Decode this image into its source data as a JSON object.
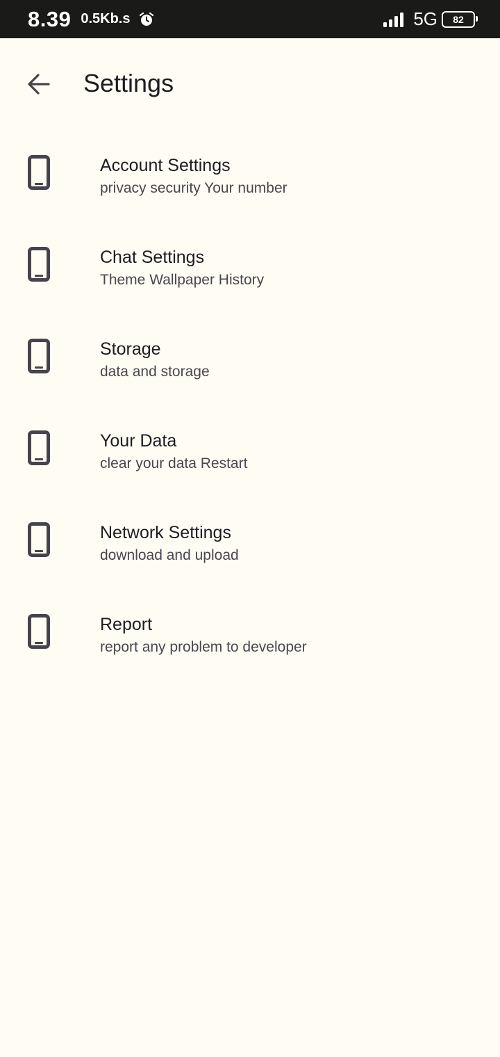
{
  "status_bar": {
    "time": "8.39",
    "speed": "0.5Kb.s",
    "network": "5G",
    "battery": "82"
  },
  "header": {
    "title": "Settings"
  },
  "settings": [
    {
      "title": "Account Settings",
      "subtitle": "privacy security Your number"
    },
    {
      "title": "Chat Settings",
      "subtitle": "Theme Wallpaper History"
    },
    {
      "title": "Storage",
      "subtitle": "data and storage"
    },
    {
      "title": "Your Data",
      "subtitle": "clear your data Restart"
    },
    {
      "title": "Network Settings",
      "subtitle": "download and upload"
    },
    {
      "title": "Report",
      "subtitle": "report any problem to developer"
    }
  ],
  "icons": {
    "back": "arrow-back-icon",
    "item": "smartphone-icon",
    "alarm": "alarm-icon",
    "signal": "signal-icon"
  },
  "colors": {
    "background": "#FFFCF4",
    "status_bar": "#1A1A18",
    "icon": "#46434C"
  }
}
